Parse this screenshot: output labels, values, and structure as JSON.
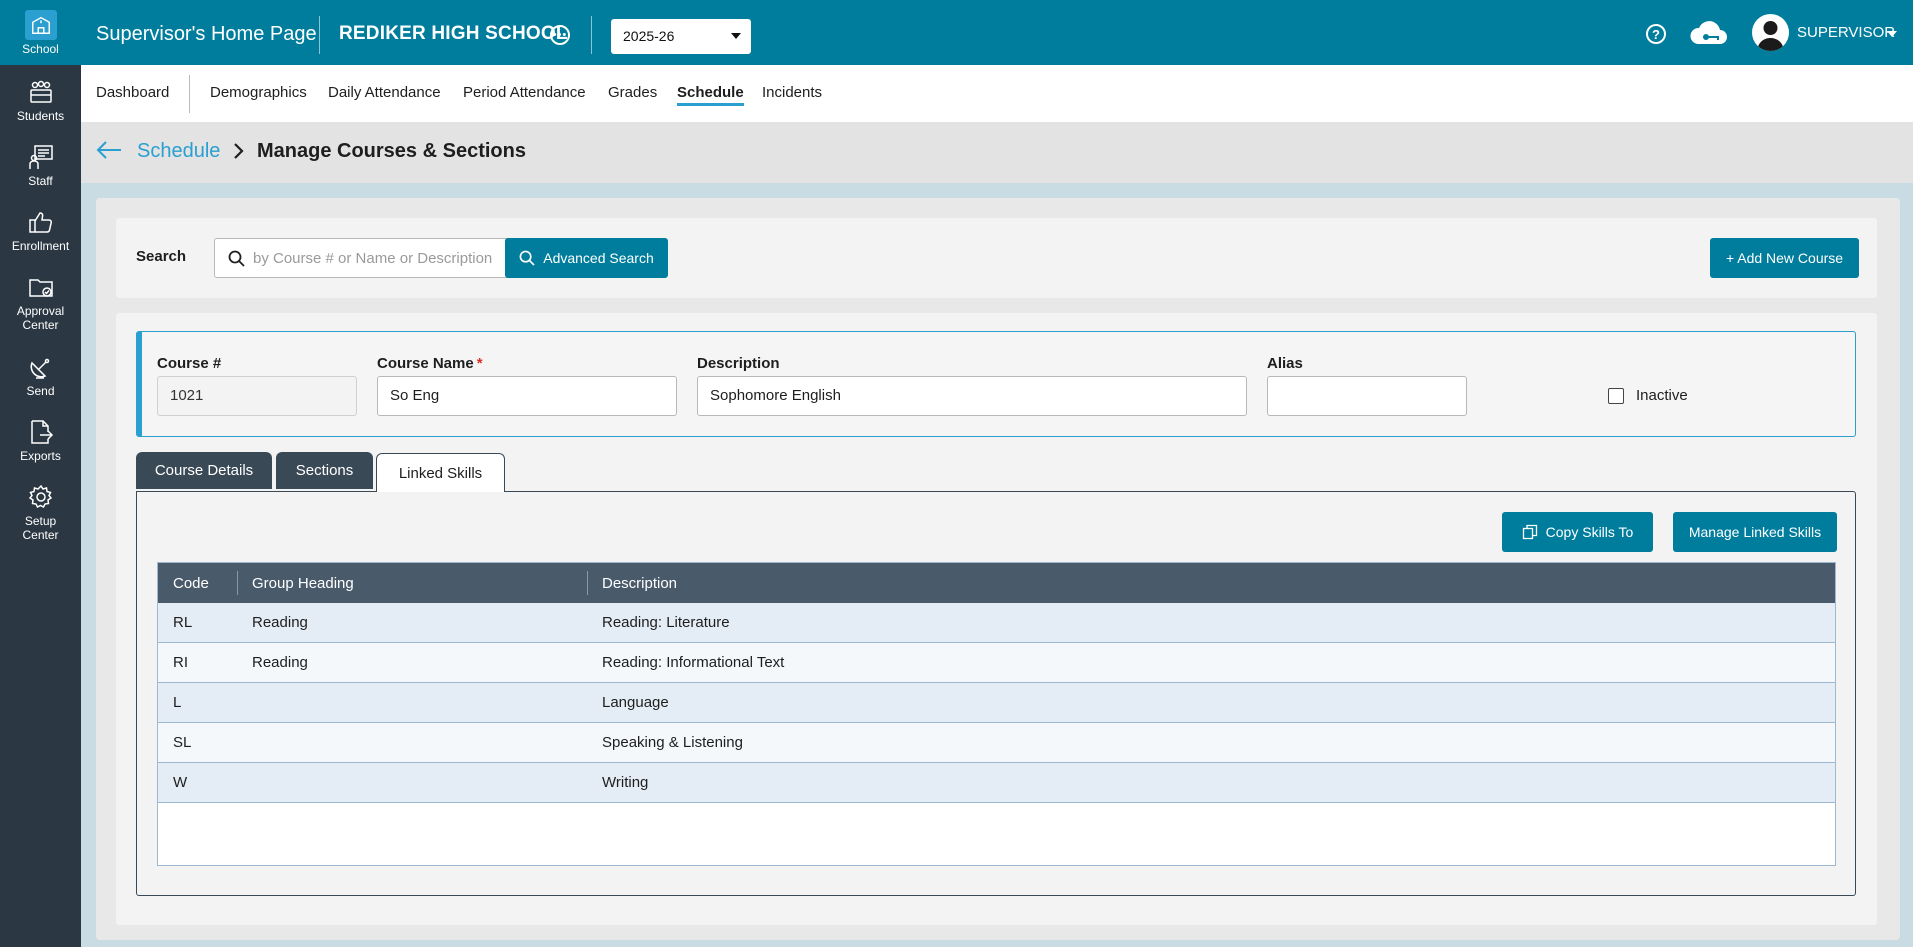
{
  "sidebar": {
    "items": [
      {
        "label": "School",
        "icon": "school-icon"
      },
      {
        "label": "Students",
        "icon": "students-icon"
      },
      {
        "label": "Staff",
        "icon": "staff-icon"
      },
      {
        "label": "Enrollment",
        "icon": "thumbs-up-icon"
      },
      {
        "label": "Approval Center",
        "icon": "folder-check-icon"
      },
      {
        "label": "Send",
        "icon": "satellite-dish-icon"
      },
      {
        "label": "Exports",
        "icon": "file-export-icon"
      },
      {
        "label": "Setup Center",
        "icon": "gear-icon"
      }
    ]
  },
  "header": {
    "title": "Supervisor's Home Page",
    "school": "REDIKER HIGH SCHOOL",
    "year": "2025-26",
    "user": "SUPERVISOR"
  },
  "subnav": {
    "items": [
      "Dashboard",
      "Demographics",
      "Daily Attendance",
      "Period Attendance",
      "Grades",
      "Schedule",
      "Incidents"
    ],
    "active": "Schedule"
  },
  "breadcrumb": {
    "parent": "Schedule",
    "current": "Manage Courses & Sections"
  },
  "search": {
    "label": "Search",
    "placeholder": "by Course # or Name or Description",
    "advanced_label": "Advanced Search",
    "add_label": "+ Add New Course"
  },
  "course": {
    "number_label": "Course #",
    "number": "1021",
    "name_label": "Course Name",
    "required_mark": "*",
    "name": "So Eng",
    "description_label": "Description",
    "description": "Sophomore English",
    "alias_label": "Alias",
    "alias": "",
    "inactive_label": "Inactive",
    "inactive": false
  },
  "tabs": [
    {
      "label": "Course Details"
    },
    {
      "label": "Sections"
    },
    {
      "label": "Linked Skills"
    }
  ],
  "active_tab": "Linked Skills",
  "skills": {
    "copy_label": "Copy Skills To",
    "manage_label": "Manage Linked Skills",
    "columns": [
      "Code",
      "Group Heading",
      "Description"
    ],
    "rows": [
      {
        "code": "RL",
        "group": "Reading",
        "description": "Reading: Literature"
      },
      {
        "code": "RI",
        "group": "Reading",
        "description": "Reading: Informational Text"
      },
      {
        "code": "L",
        "group": "",
        "description": "Language"
      },
      {
        "code": "SL",
        "group": "",
        "description": "Speaking & Listening"
      },
      {
        "code": "W",
        "group": "",
        "description": "Writing"
      }
    ]
  },
  "colors": {
    "brand": "#007d9c",
    "sidebar": "#2b3742",
    "accent": "#2a9fd0",
    "tab_dark": "#3a4956",
    "grid_header": "#495a6b"
  }
}
